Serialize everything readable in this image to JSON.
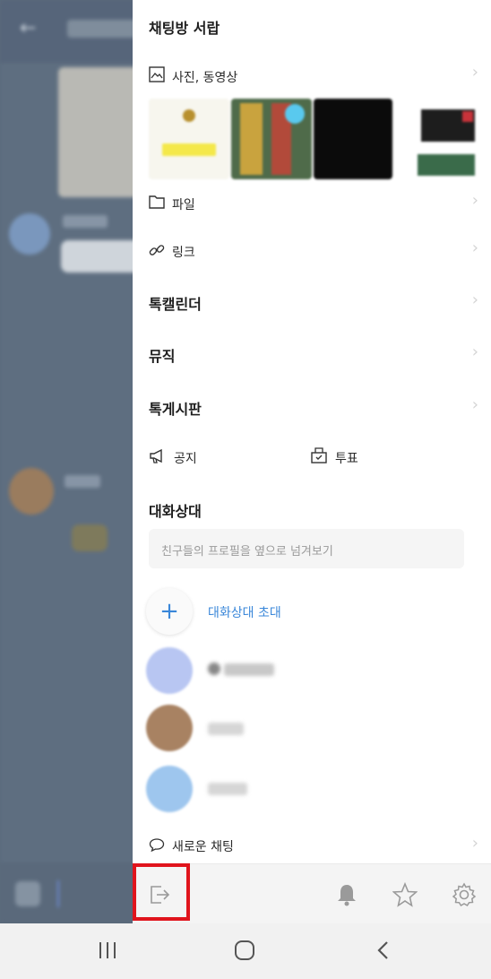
{
  "drawer": {
    "title": "채팅방 서랍",
    "media_label": "사진, 동영상",
    "file_label": "파일",
    "link_label": "링크",
    "calendar_label": "톡캘린더",
    "music_label": "뮤직",
    "board_label": "톡게시판",
    "notice_label": "공지",
    "vote_label": "투표",
    "members_title": "대화상대",
    "members_hint": "친구들의 프로필을 옆으로 넘겨보기",
    "invite_label": "대화상대 초대",
    "new_chat_label": "새로운 채팅"
  },
  "colors": {
    "accent": "#3a87d9",
    "highlight": "#e0141c"
  },
  "icons": {
    "media": "image-icon",
    "file": "folder-icon",
    "link": "link-icon",
    "notice": "megaphone-icon",
    "vote": "ballot-box-icon",
    "invite": "plus-icon",
    "new_chat": "chat-bubble-icon",
    "exit": "exit-icon",
    "bell": "bell-icon",
    "star": "star-icon",
    "settings": "gear-icon"
  }
}
